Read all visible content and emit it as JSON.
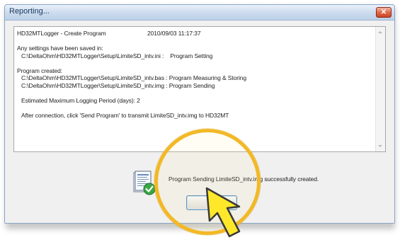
{
  "window": {
    "title": "Reporting..."
  },
  "report": {
    "header_program": "HD32MTLogger - Create Program",
    "header_datetime": "2010/09/03 11:17:37",
    "settings_saved_label": "Any settings have been saved in:",
    "settings_path_line": "C:\\DeltaOhm\\HD32MTLogger\\Setup\\LimiteSD_intv.ini :    Program Setting",
    "program_created_label": "Program created:",
    "program_bas_line": "C:\\DeltaOhm\\HD32MTLogger\\Setup\\LimiteSD_intv.bas : Program Measuring & Storing",
    "program_img_line": "C:\\DeltaOhm\\HD32MTLogger\\Setup\\LimiteSD_intv.img : Program Sending",
    "logging_period_line": "Estimated Maximum Logging Period (days): 2",
    "after_connection_line": "After connection, click 'Send Program' to transmit LimiteSD_intv.img to HD32MT"
  },
  "footer": {
    "status_message": "Program Sending LimiteSD_intv.img successfully created.",
    "ok_label": "OK"
  },
  "icons": {
    "close": "close-icon",
    "document_check": "document-check-icon",
    "pointer_arrow": "arrow-pointer-icon"
  },
  "colors": {
    "highlight_ring": "#f2b826",
    "pointer_fill": "#ffe82a",
    "pointer_stroke": "#3a3a3a",
    "close_button": "#e06a4a",
    "check_mark": "#2e9a3a"
  }
}
